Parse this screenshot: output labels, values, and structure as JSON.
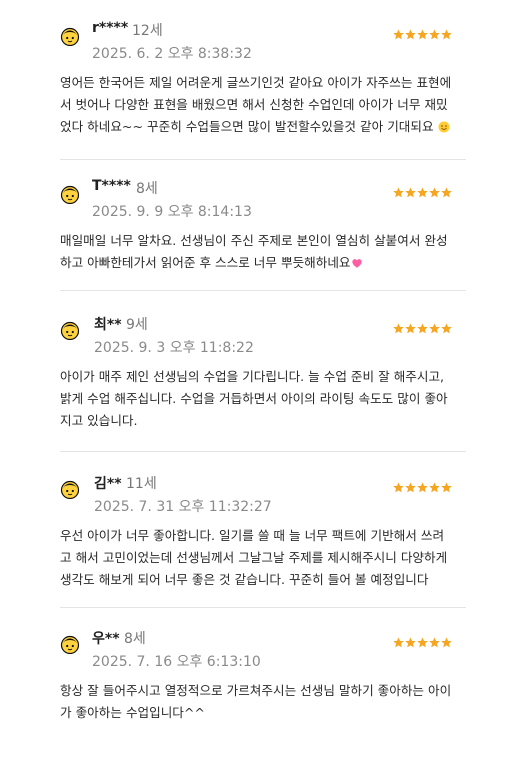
{
  "colors": {
    "star": "#f5a623",
    "text": "#222222",
    "muted": "#8a8a8a",
    "divider": "#e4e4e4"
  },
  "reviews": [
    {
      "name": "r****",
      "age": "12세",
      "date": "2025. 6. 2 오후 8:38:32",
      "rating": 5,
      "text": "영어든 한국어든 제일 어려운게 글쓰기인것 같아요 아이가 자주쓰는 표현에서 벗어나 다양한 표현을 배웠으면 해서 신청한 수업인데 아이가 너무 재밌었다 하네요~~ 꾸준히 수업들으면 많이 발전할수있을것 같아 기대되요",
      "emoji": "smile-emoji"
    },
    {
      "name": "T****",
      "age": "8세",
      "date": "2025. 9. 9 오후 8:14:13",
      "rating": 5,
      "text": "매일매일 너무 알차요. 선생님이 주신 주제로 본인이 열심히 살붙여서 완성하고 아빠한테가서 읽어준 후 스스로 너무 뿌듯해하네요",
      "emoji": "heart-emoji"
    },
    {
      "name": "최**",
      "age": "9세",
      "date": "2025. 9. 3 오후 11:8:22",
      "rating": 5,
      "text": "아이가 매주 제인 선생님의 수업을 기다립니다. 늘 수업 준비 잘 해주시고, 밝게 수업 해주십니다. 수업을 거듭하면서 아이의 라이팅 속도도 많이 좋아지고 있습니다."
    },
    {
      "name": "김**",
      "age": "11세",
      "date": "2025. 7. 31 오후 11:32:27",
      "rating": 5,
      "text": "우선 아이가 너무 좋아합니다. 일기를 쓸 때 늘 너무 팩트에 기반해서 쓰려고 해서 고민이었는데 선생님께서 그날그날 주제를 제시해주시니 다양하게 생각도 해보게 되어 너무 좋은 것 같습니다. 꾸준히 들어 볼 예정입니다"
    },
    {
      "name": "우**",
      "age": "8세",
      "date": "2025. 7. 16 오후 6:13:10",
      "rating": 5,
      "text": "항상 잘 들어주시고 열정적으로 가르쳐주시는 선생님 말하기 좋아하는 아이가 좋아하는 수업입니다^^"
    }
  ]
}
